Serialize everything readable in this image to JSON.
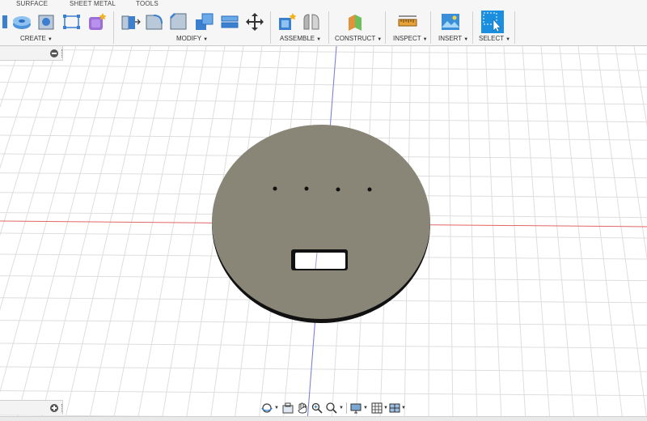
{
  "toolbar": {
    "tabs": [
      "SURFACE",
      "SHEET METAL",
      "TOOLS"
    ],
    "groups": {
      "create": "CREATE",
      "modify": "MODIFY",
      "assemble": "ASSEMBLE",
      "construct": "CONSTRUCT",
      "inspect": "INSPECT",
      "insert": "INSERT",
      "select": "SELECT"
    },
    "icons": {
      "create": [
        "extrude-icon",
        "revolve-icon",
        "hole-icon",
        "sketch-rectangle-icon",
        "create-form-icon"
      ],
      "modify": [
        "press-pull-icon",
        "fillet-icon",
        "chamfer-icon",
        "combine-icon",
        "shell-icon",
        "move-icon"
      ],
      "assemble": [
        "new-component-icon",
        "joint-icon"
      ],
      "construct": [
        "offset-plane-icon"
      ],
      "inspect": [
        "measure-icon"
      ],
      "insert": [
        "insert-image-icon"
      ],
      "select": [
        "select-cursor-icon"
      ]
    }
  },
  "viewport": {
    "background": "#ffffff",
    "grid_color": "#dedede",
    "x_axis_color": "#e06666",
    "y_axis_color": "#7a7ad8",
    "part": {
      "shape": "circular-plate",
      "fill": "#898678",
      "edge": "#111111",
      "hole_count": 4,
      "slot_count": 1
    }
  },
  "navbar": {
    "icons": [
      "orbit-icon",
      "look-at-icon",
      "pan-icon",
      "zoom-window-icon",
      "fit-icon",
      "display-settings-icon",
      "grid-settings-icon",
      "viewports-icon"
    ]
  },
  "panels": {
    "browser": "browser-panel",
    "comments": "comments-panel"
  }
}
